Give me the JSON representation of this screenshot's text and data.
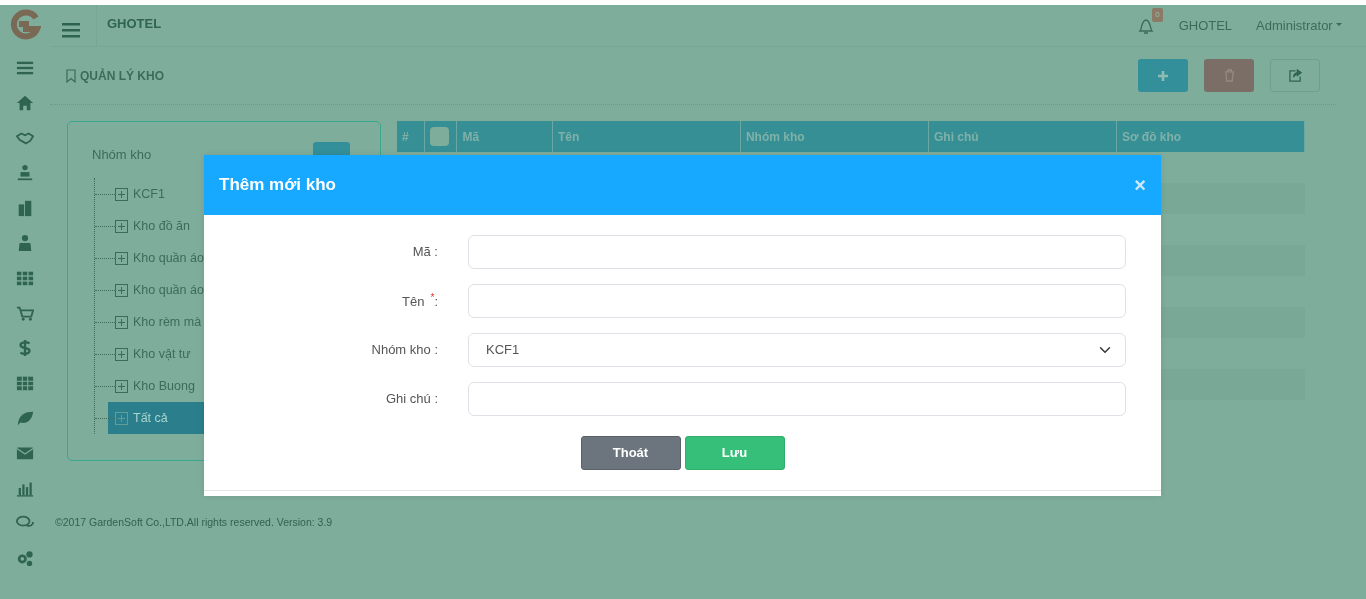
{
  "header": {
    "brand": "GHOTEL",
    "notification_count": "0",
    "hotel": "GHOTEL",
    "user": "Administrator"
  },
  "breadcrumb": "QUẢN LÝ KHO",
  "tree": {
    "title": "Nhóm kho",
    "items": [
      {
        "label": "KCF1",
        "selected": false
      },
      {
        "label": "Kho đồ ăn",
        "selected": false
      },
      {
        "label": "Kho quần áo",
        "selected": false
      },
      {
        "label": "Kho quần áo",
        "selected": false
      },
      {
        "label": "Kho rèm mà",
        "selected": false
      },
      {
        "label": "Kho vật tư",
        "selected": false
      },
      {
        "label": "Kho Buong",
        "selected": false
      },
      {
        "label": "Tất cả",
        "selected": true
      }
    ]
  },
  "table": {
    "select_all": {
      "checked": false
    },
    "columns": [
      "#",
      "Mã",
      "Tên",
      "Nhóm kho",
      "Ghi chú",
      "Sơ đồ kho"
    ]
  },
  "footer": "©2017 GardenSoft Co.,LTD.All rights reserved. Version: 3.9",
  "modal": {
    "title": "Thêm mới kho",
    "close": "×",
    "fields": [
      {
        "kind": "text",
        "label": "Mã :"
      },
      {
        "kind": "text",
        "label": "Tên",
        "required_mark": "*",
        "colon": ":"
      },
      {
        "kind": "select",
        "label": "Nhóm kho :",
        "value": "KCF1"
      },
      {
        "kind": "text",
        "label": "Ghi chú :"
      }
    ],
    "buttons": [
      {
        "kind": "secondary",
        "label": "Thoát"
      },
      {
        "kind": "success",
        "label": "Lưu"
      }
    ]
  }
}
